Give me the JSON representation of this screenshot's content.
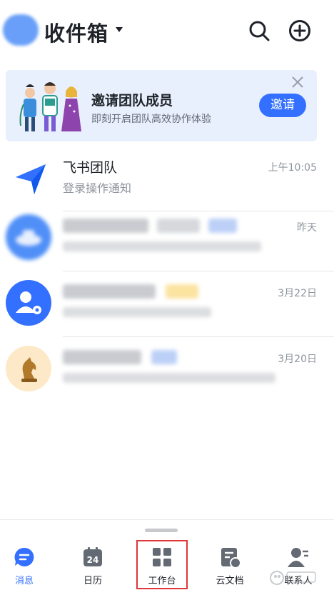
{
  "header": {
    "title": "收件箱"
  },
  "banner": {
    "title": "邀请团队成员",
    "subtitle": "即刻开启团队高效协作体验",
    "button_label": "邀请"
  },
  "chats": [
    {
      "name": "飞书团队",
      "preview": "登录操作通知",
      "time": "上午10:05",
      "avatar": "paper-plane-icon"
    },
    {
      "name": "",
      "preview": "",
      "time": "昨天",
      "avatar": "blurred-avatar"
    },
    {
      "name": "",
      "preview": "",
      "time": "3月22日",
      "avatar": "user-settings-icon"
    },
    {
      "name": "",
      "preview": "",
      "time": "3月20日",
      "avatar": "chess-knight-icon"
    }
  ],
  "tabs": [
    {
      "label": "消息",
      "icon": "message-icon",
      "active": true
    },
    {
      "label": "日历",
      "icon": "calendar-icon",
      "day": "24"
    },
    {
      "label": "工作台",
      "icon": "workspace-grid-icon"
    },
    {
      "label": "云文档",
      "icon": "cloud-doc-icon"
    },
    {
      "label": "联系人",
      "icon": "contacts-icon"
    }
  ],
  "colors": {
    "accent": "#3370ff",
    "highlight_box": "#e0353b",
    "banner_bg": "#e8effd"
  }
}
